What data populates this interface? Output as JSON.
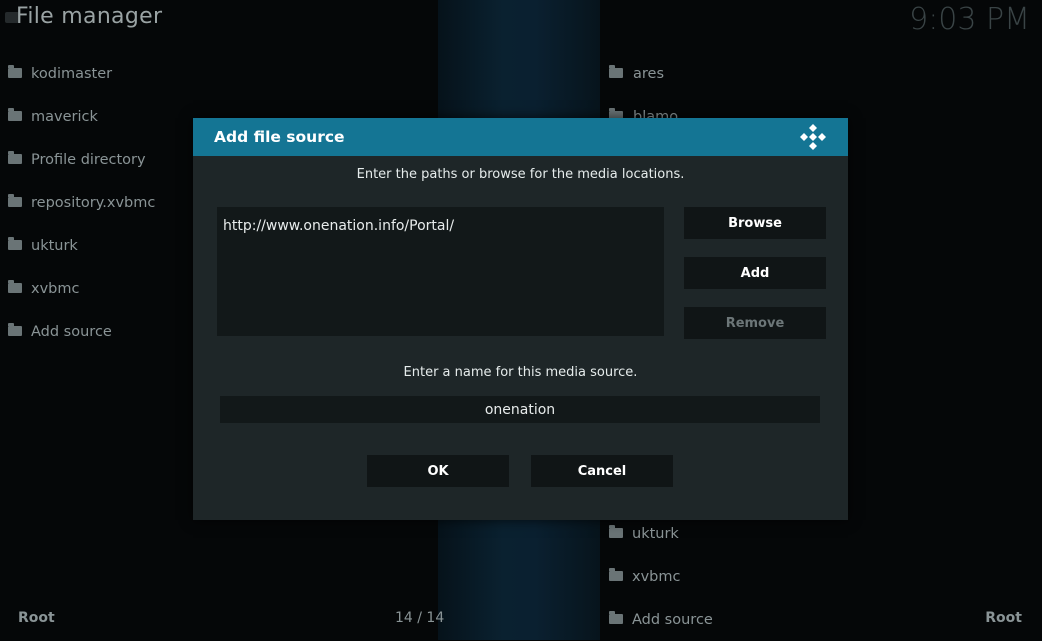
{
  "header": {
    "title": "File manager",
    "clock": "9:03 PM"
  },
  "left_list": [
    {
      "label": "kodimaster"
    },
    {
      "label": "maverick"
    },
    {
      "label": "Profile directory"
    },
    {
      "label": "repository.xvbmc"
    },
    {
      "label": "ukturk"
    },
    {
      "label": "xvbmc"
    },
    {
      "label": "Add source"
    }
  ],
  "right_list_top": [
    {
      "label": "ares"
    },
    {
      "label": "blamo"
    }
  ],
  "right_list_bottom": [
    {
      "label": "ukturk"
    },
    {
      "label": "xvbmc"
    },
    {
      "label": "Add source"
    }
  ],
  "footer": {
    "left": "Root",
    "count": "14 / 14",
    "right": "Root"
  },
  "dialog": {
    "title": "Add file source",
    "instruction_paths": "Enter the paths or browse for the media locations.",
    "paths": [
      "http://www.onenation.info/Portal/"
    ],
    "buttons": {
      "browse": "Browse",
      "add": "Add",
      "remove": "Remove"
    },
    "instruction_name": "Enter a name for this media source.",
    "name_value": "onenation",
    "ok": "OK",
    "cancel": "Cancel"
  },
  "colors": {
    "header_bar": "#147594",
    "dialog_bg": "#1e2628",
    "background": "#050708"
  }
}
